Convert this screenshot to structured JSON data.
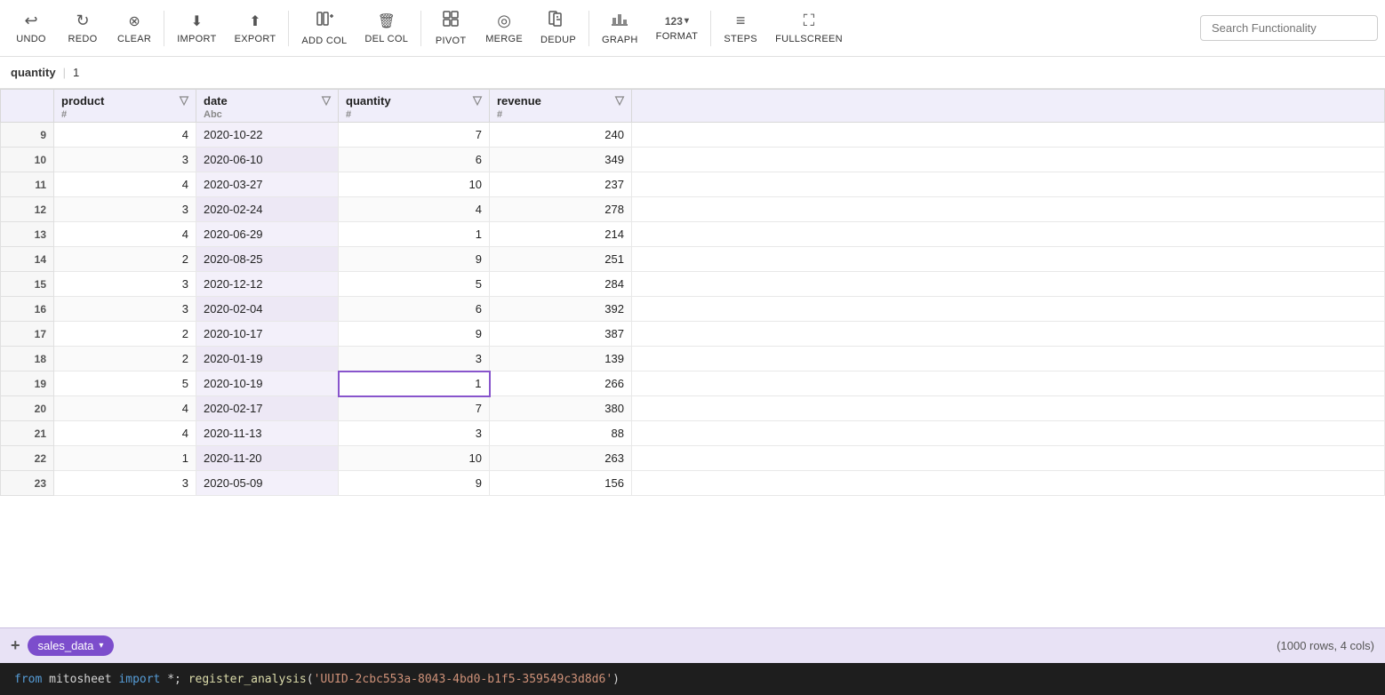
{
  "toolbar": {
    "buttons": [
      {
        "id": "undo",
        "label": "UNDO",
        "icon": "↩"
      },
      {
        "id": "redo",
        "label": "REDO",
        "icon": "↻"
      },
      {
        "id": "clear",
        "label": "CLEAR",
        "icon": "⊗"
      },
      {
        "id": "import",
        "label": "IMPORT",
        "icon": "⬇"
      },
      {
        "id": "export",
        "label": "EXPORT",
        "icon": "⬆"
      },
      {
        "id": "add-col",
        "label": "ADD COL",
        "icon": "⊕"
      },
      {
        "id": "del-col",
        "label": "DEL COL",
        "icon": "🗑"
      },
      {
        "id": "pivot",
        "label": "PIVOT",
        "icon": "⊞"
      },
      {
        "id": "merge",
        "label": "MERGE",
        "icon": "◎"
      },
      {
        "id": "dedup",
        "label": "DEDUP",
        "icon": "❑❑"
      },
      {
        "id": "graph",
        "label": "GRAPH",
        "icon": "📊"
      },
      {
        "id": "format",
        "label": "FORMAT",
        "icon": "123"
      },
      {
        "id": "steps",
        "label": "STEPS",
        "icon": "≡"
      },
      {
        "id": "fullscreen",
        "label": "FULLSCREEN",
        "icon": "⛶"
      }
    ],
    "search_placeholder": "Search Functionality"
  },
  "formula_bar": {
    "cell_ref": "quantity",
    "separator": "|",
    "cell_value": "1"
  },
  "columns": [
    {
      "id": "product",
      "label": "product",
      "type": "#"
    },
    {
      "id": "date",
      "label": "date",
      "type": "Abc"
    },
    {
      "id": "quantity",
      "label": "quantity",
      "type": "#"
    },
    {
      "id": "revenue",
      "label": "revenue",
      "type": "#"
    }
  ],
  "rows": [
    {
      "rownum": 9,
      "product": 4,
      "date": "2020-10-22",
      "quantity": 7,
      "revenue": 240
    },
    {
      "rownum": 10,
      "product": 3,
      "date": "2020-06-10",
      "quantity": 6,
      "revenue": 349
    },
    {
      "rownum": 11,
      "product": 4,
      "date": "2020-03-27",
      "quantity": 10,
      "revenue": 237
    },
    {
      "rownum": 12,
      "product": 3,
      "date": "2020-02-24",
      "quantity": 4,
      "revenue": 278
    },
    {
      "rownum": 13,
      "product": 4,
      "date": "2020-06-29",
      "quantity": 1,
      "revenue": 214
    },
    {
      "rownum": 14,
      "product": 2,
      "date": "2020-08-25",
      "quantity": 9,
      "revenue": 251
    },
    {
      "rownum": 15,
      "product": 3,
      "date": "2020-12-12",
      "quantity": 5,
      "revenue": 284
    },
    {
      "rownum": 16,
      "product": 3,
      "date": "2020-02-04",
      "quantity": 6,
      "revenue": 392
    },
    {
      "rownum": 17,
      "product": 2,
      "date": "2020-10-17",
      "quantity": 9,
      "revenue": 387
    },
    {
      "rownum": 18,
      "product": 2,
      "date": "2020-01-19",
      "quantity": 3,
      "revenue": 139
    },
    {
      "rownum": 19,
      "product": 5,
      "date": "2020-10-19",
      "quantity": 1,
      "revenue": 266,
      "selected_qty": true
    },
    {
      "rownum": 20,
      "product": 4,
      "date": "2020-02-17",
      "quantity": 7,
      "revenue": 380
    },
    {
      "rownum": 21,
      "product": 4,
      "date": "2020-11-13",
      "quantity": 3,
      "revenue": 88
    },
    {
      "rownum": 22,
      "product": 1,
      "date": "2020-11-20",
      "quantity": 10,
      "revenue": 263
    },
    {
      "rownum": 23,
      "product": 3,
      "date": "2020-05-09",
      "quantity": 9,
      "revenue": 156
    }
  ],
  "bottom_bar": {
    "add_sheet_label": "+",
    "sheet_name": "sales_data",
    "chevron": "▾",
    "row_count": "(1000 rows, 4 cols)"
  },
  "code_bar": {
    "line": "from mitosheet import *; register_analysis('UUID-2cbc553a-8043-4bd0-b1f5-359549c3d8d6')"
  }
}
